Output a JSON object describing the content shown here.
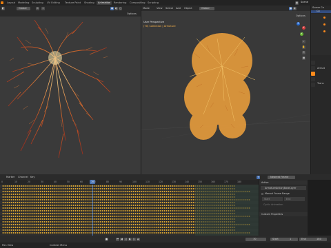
{
  "workspace_tabs": [
    "Layout",
    "Modeling",
    "Sculpting",
    "UV Editing",
    "Texture Paint",
    "Shading",
    "Animation",
    "Rendering",
    "Compositing",
    "Scripting"
  ],
  "active_tab_index": 6,
  "scene_label": "Scene",
  "left_view": {
    "orientation": "Global",
    "options_label": "Options"
  },
  "right_view": {
    "mode": "Mode",
    "menus": [
      "View",
      "Select",
      "Add",
      "Object"
    ],
    "orientation": "Global",
    "options_label": "Options",
    "view_title": "User Perspective",
    "view_subtitle": "(70) Collection | Armature"
  },
  "outliner": {
    "title": "Scene Co",
    "item": "Co",
    "props_label": "Armat",
    "transform_label": "Trans"
  },
  "timeline": {
    "menus": [
      "Marker",
      "Channel",
      "Key"
    ],
    "current_frame": "70",
    "frame_ticks": [
      "0",
      "10",
      "20",
      "30",
      "40",
      "50",
      "60",
      "70",
      "80",
      "90",
      "100",
      "110",
      "120",
      "130",
      "140",
      "150",
      "160",
      "170",
      "180"
    ],
    "keyframe_menu": "Nearest Frame",
    "active_panel": "Active",
    "action_name": "ArmatureAction|BaseLayer",
    "manual_frame_range": "Manual Frame Range",
    "start_label": "Start",
    "end_label": "End",
    "cyclic_label": "Cyclic Animation",
    "custom_props": "Custom Properties"
  },
  "playback": {
    "current": "70",
    "start_label": "Start",
    "start": "1",
    "end_label": "End",
    "end": "180"
  },
  "status": {
    "left": "Pan View",
    "right": "Context Menu"
  },
  "colors": {
    "accent": "#4772b3",
    "keyframe": "#d8a431",
    "selection_orange": "#ff8b1c",
    "playhead": "#4772b3"
  },
  "icons": [
    "hand-icon",
    "camera-icon",
    "grid-icon",
    "gear-icon",
    "play-icon",
    "record-icon",
    "filter-icon"
  ]
}
